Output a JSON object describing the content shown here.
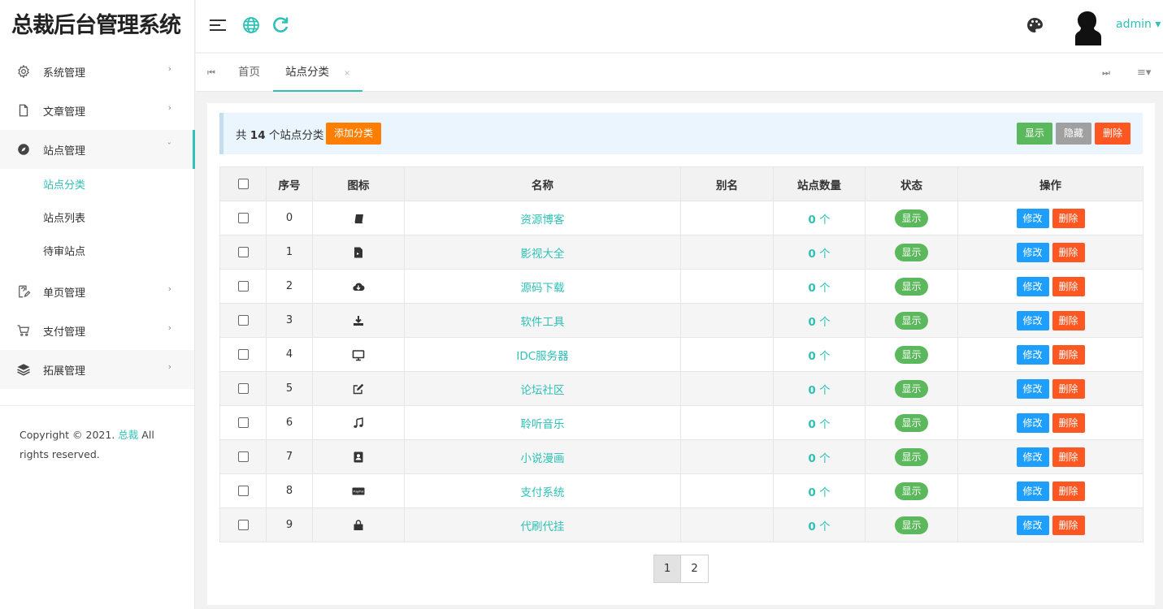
{
  "app": {
    "title": "总裁后台管理系统"
  },
  "sidebar": {
    "menus": [
      {
        "label": "系统管理",
        "icon": "gear-icon",
        "arrow": "›"
      },
      {
        "label": "文章管理",
        "icon": "document-icon",
        "arrow": "›"
      },
      {
        "label": "站点管理",
        "icon": "compass-icon",
        "arrow": "ˇ"
      },
      {
        "label": "单页管理",
        "icon": "page-edit-icon",
        "arrow": "›"
      },
      {
        "label": "支付管理",
        "icon": "cart-icon",
        "arrow": "›"
      },
      {
        "label": "拓展管理",
        "icon": "layers-icon",
        "arrow": "›"
      }
    ],
    "submenu": [
      "站点分类",
      "站点列表",
      "待审站点"
    ],
    "copyright_prefix": "Copyright © 2021.",
    "copyright_link": "总裁",
    "copyright_suffix": "All rights reserved."
  },
  "header": {
    "user": "admin",
    "user_arrow": "▾",
    "icons": [
      "menu-fold-icon",
      "globe-icon",
      "refresh-icon",
      "palette-icon"
    ]
  },
  "tabs": {
    "items": [
      {
        "label": "首页"
      },
      {
        "label": "站点分类",
        "close": "×"
      }
    ],
    "prev": "⏮",
    "next": "⏭",
    "more": "≡▾"
  },
  "toolbar": {
    "prefix": "共",
    "count": "14",
    "suffix": "个站点分类",
    "add": "添加分类",
    "show": "显示",
    "hide": "隐藏",
    "delete": "删除",
    "colors": {
      "add": "#ff7e00",
      "show": "#5cb85c",
      "hide": "#a0a0a0",
      "delete": "#ff5722"
    }
  },
  "table": {
    "headers": [
      "序号",
      "图标",
      "名称",
      "别名",
      "站点数量",
      "状态",
      "操作"
    ],
    "rows": [
      {
        "id": "0",
        "icon": "book-icon",
        "name": "资源博客",
        "alias": "",
        "count": "0",
        "unit": "个",
        "status": "显示"
      },
      {
        "id": "1",
        "icon": "video-file-icon",
        "name": "影视大全",
        "alias": "",
        "count": "0",
        "unit": "个",
        "status": "显示"
      },
      {
        "id": "2",
        "icon": "cloud-download-icon",
        "name": "源码下载",
        "alias": "",
        "count": "0",
        "unit": "个",
        "status": "显示"
      },
      {
        "id": "3",
        "icon": "download-icon",
        "name": "软件工具",
        "alias": "",
        "count": "0",
        "unit": "个",
        "status": "显示"
      },
      {
        "id": "4",
        "icon": "monitor-icon",
        "name": "IDC服务器",
        "alias": "",
        "count": "0",
        "unit": "个",
        "status": "显示"
      },
      {
        "id": "5",
        "icon": "edit-icon",
        "name": "论坛社区",
        "alias": "",
        "count": "0",
        "unit": "个",
        "status": "显示"
      },
      {
        "id": "6",
        "icon": "music-icon",
        "name": "聆听音乐",
        "alias": "",
        "count": "0",
        "unit": "个",
        "status": "显示"
      },
      {
        "id": "7",
        "icon": "address-book-icon",
        "name": "小说漫画",
        "alias": "",
        "count": "0",
        "unit": "个",
        "status": "显示"
      },
      {
        "id": "8",
        "icon": "paypal-icon",
        "name": "支付系统",
        "alias": "",
        "count": "0",
        "unit": "个",
        "status": "显示"
      },
      {
        "id": "9",
        "icon": "shopping-bag-icon",
        "name": "代刷代挂",
        "alias": "",
        "count": "0",
        "unit": "个",
        "status": "显示"
      }
    ],
    "edit_label": "修改",
    "delete_label": "删除"
  },
  "pagination": {
    "pages": [
      "1",
      "2"
    ],
    "current": "1"
  },
  "theme": {
    "accent": "#2fc1b6",
    "edit": "#1e9fff",
    "delete": "#ff5722",
    "status": "#5cb85c"
  }
}
